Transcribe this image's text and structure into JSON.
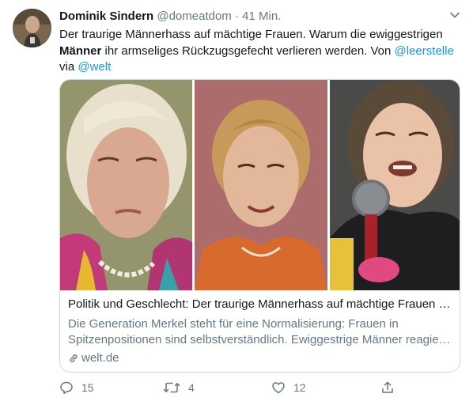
{
  "tweet": {
    "author_name": "Dominik Sindern",
    "handle": "@domeatdom",
    "separator": "·",
    "time": "41 Min.",
    "text_part1": "Der traurige Männerhass auf mächtige Frauen. Warum die ewiggestrigen ",
    "text_bold": "Männer",
    "text_part2": " ihr armseliges Rückzugsgefecht verlieren werden. Von ",
    "mention1": "@leerstelle",
    "text_part3": "via ",
    "mention2": "@welt"
  },
  "card": {
    "title": "Politik und Geschlecht: Der traurige Männerhass auf mächtige Frauen - ...",
    "desc_line1": "Die Generation Merkel steht für eine Normalisierung: Frauen in",
    "desc_line2": "Spitzenpositionen sind selbstverständlich. Ewiggestrige Männer reagier...",
    "domain": "welt.de"
  },
  "actions": {
    "replies": "15",
    "retweets": "4",
    "likes": "12"
  },
  "colors": {
    "link": "#1b95e0",
    "muted": "#657786",
    "border": "#ccd6dd"
  }
}
